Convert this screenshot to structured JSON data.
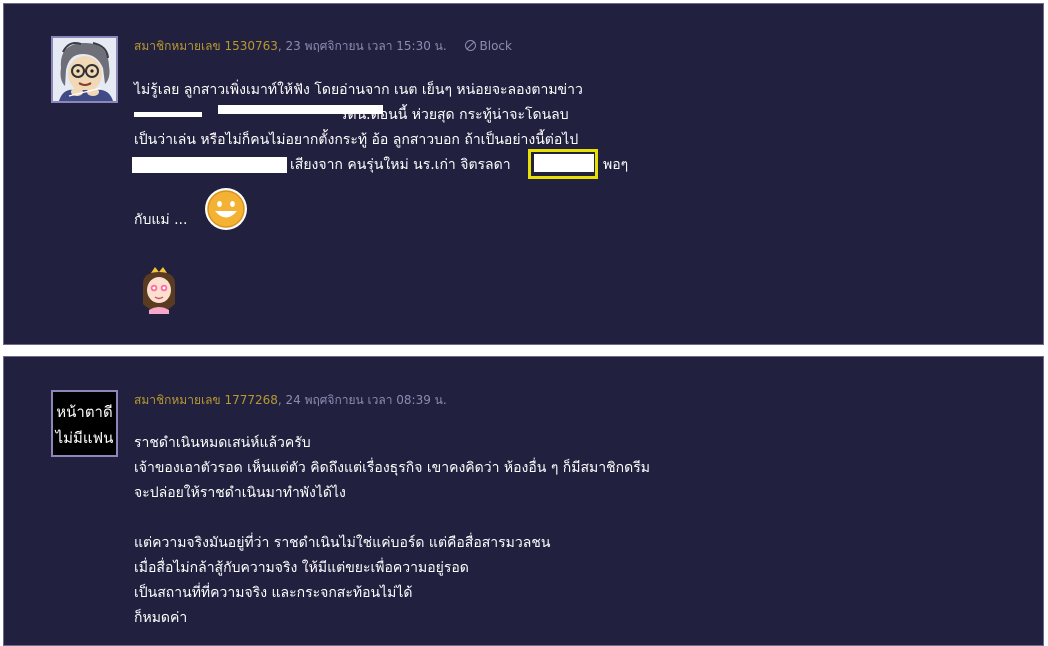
{
  "comments": [
    {
      "member_prefix": "สมาชิกหมายเลข",
      "member_id": "1530763",
      "datetime": ", 23 พฤศจิกายน เวลา 15:30 น.",
      "block_label": "Block",
      "lines": [
        "ไม่รู้เลย  ลูกสาวเพิ่งเมาท์ให้ฟัง  โดยอ่านจาก เนต  เย็นๆ หน่อยจะลองตามข่าว",
        "รดน.ตอนนี้  ห่วยสุด  กระทู้น่าจะโดนลบ",
        "เป็นว่าเล่น  หรือไม่ก็คนไม่อยากตั้งกระทู้ อ้อ  ลูกสาวบอก  ถ้าเป็นอย่างนี้ต่อไป",
        "เสียงจาก  คนรุ่นใหม่  นร.เก่า จิตรลดา",
        "พอๆ",
        "กับแม่ ..."
      ]
    },
    {
      "member_prefix": "สมาชิกหมายเลข",
      "member_id": "1777268",
      "datetime": ", 24 พฤศจิกายน เวลา 08:39 น.",
      "avatar_text": [
        "หน้าตาดี",
        "ไม่มีแฟน"
      ],
      "lines": [
        "ราชดำเนินหมดเสน่ห์แล้วครับ",
        "เจ้าของเอาตัวรอด  เห็นแต่ตัว  คิดถึงแต่เรื่องธุรกิจ  เขาคงคิดว่า ห้องอื่น ๆ ก็มีสมาชิกดรีม",
        "จะปล่อยให้ราชดำเนินมาทำพังได้ไง",
        "",
        "แต่ความจริงมันอยู่ที่ว่า  ราชดำเนินไม่ใช่แค่บอร์ด  แต่คือสื่อสารมวลชน",
        "เมื่อสื่อไม่กล้าสู้กับความจริง  ให้มีแต่ขยะเพื่อความอยู่รอด",
        "เป็นสถานที่ที่ความจริง  และกระจกสะท้อนไม่ได้",
        "ก็หมดค่า"
      ]
    }
  ],
  "colors": {
    "panel_bg": "#21203f",
    "panel_border": "#6d6a8f",
    "member_color": "#b79a2f",
    "meta_color": "#8f8bb0",
    "text_color": "#ffffff",
    "highlight": "#e8e000"
  },
  "icons": {
    "block": "block-icon",
    "smiley": "smiley-emoticon",
    "princess": "princess-emoticon"
  }
}
